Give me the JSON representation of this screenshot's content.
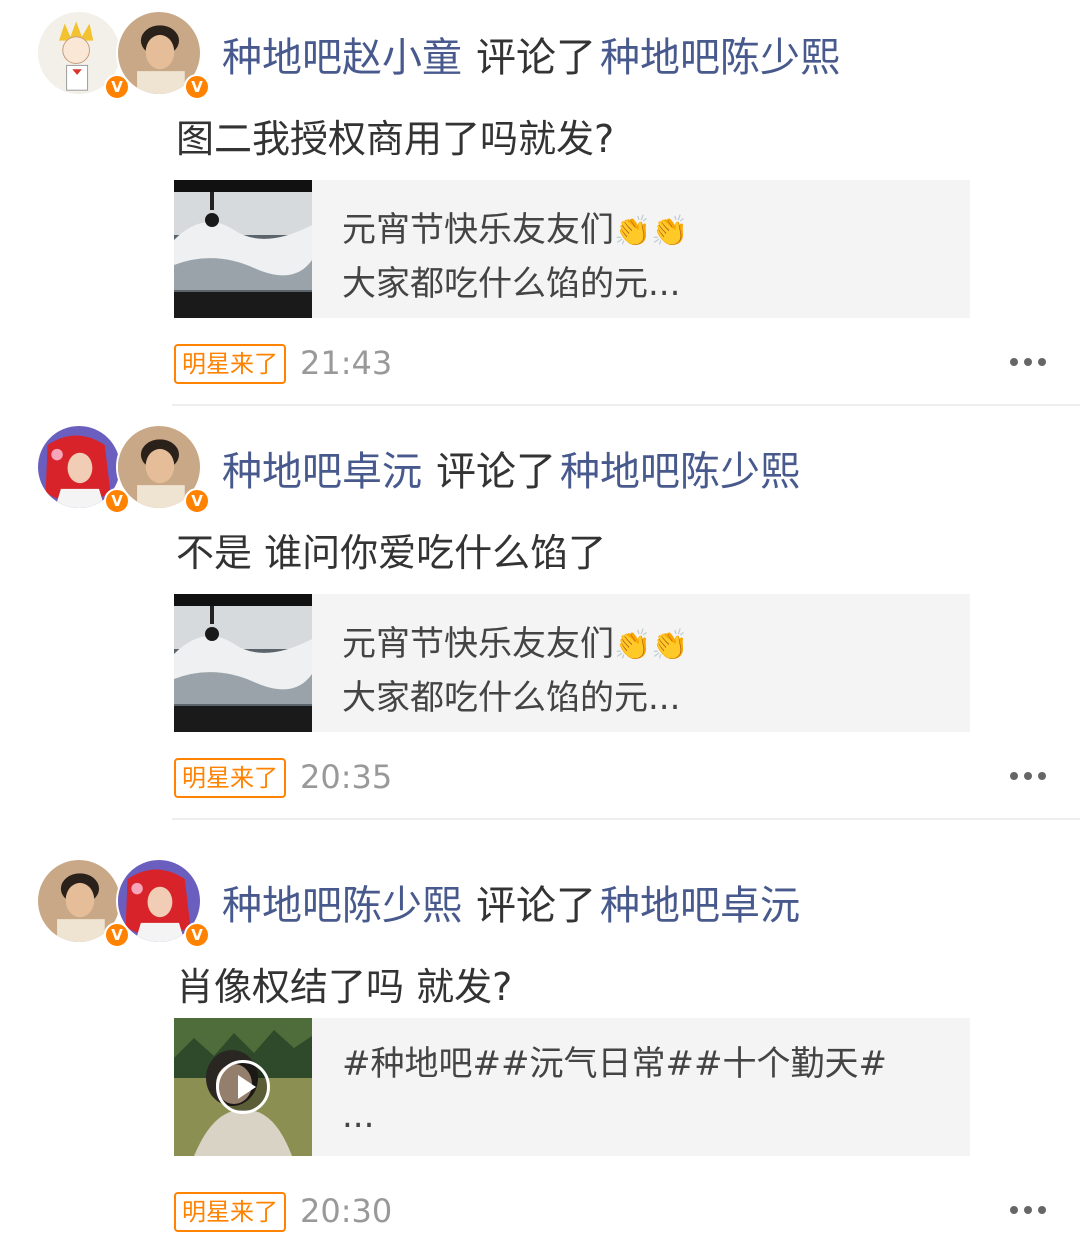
{
  "comments": [
    {
      "commenter": "种地吧赵小童",
      "verb": "评论了",
      "target": "种地吧陈少熙",
      "text": "图二我授权商用了吗就发?",
      "card_lines": [
        "元宵节快乐友友们",
        "大家都吃什么馅的元..."
      ],
      "card_emoji": "👏👏",
      "tag": "明星来了",
      "time": "21:43"
    },
    {
      "commenter": "种地吧卓沅",
      "verb": "评论了",
      "target": "种地吧陈少熙",
      "text": "不是 谁问你爱吃什么馅了",
      "card_lines": [
        "元宵节快乐友友们",
        "大家都吃什么馅的元..."
      ],
      "card_emoji": "👏👏",
      "tag": "明星来了",
      "time": "20:35"
    },
    {
      "commenter": "种地吧陈少熙",
      "verb": "评论了",
      "target": "种地吧卓沅",
      "text": "肖像权结了吗 就发?",
      "card_lines": [
        "#种地吧##沅气日常##十个勤天#",
        "..."
      ],
      "tag": "明星来了",
      "time": "20:30"
    }
  ],
  "verified_badge": "V",
  "icons": {
    "more": "more-dots-icon",
    "play": "play-icon",
    "verified": "verified-v-icon"
  },
  "colors": {
    "nickname": "#485a8d",
    "accent": "#ff8200",
    "card_bg": "#f4f4f4",
    "time": "#999999"
  }
}
